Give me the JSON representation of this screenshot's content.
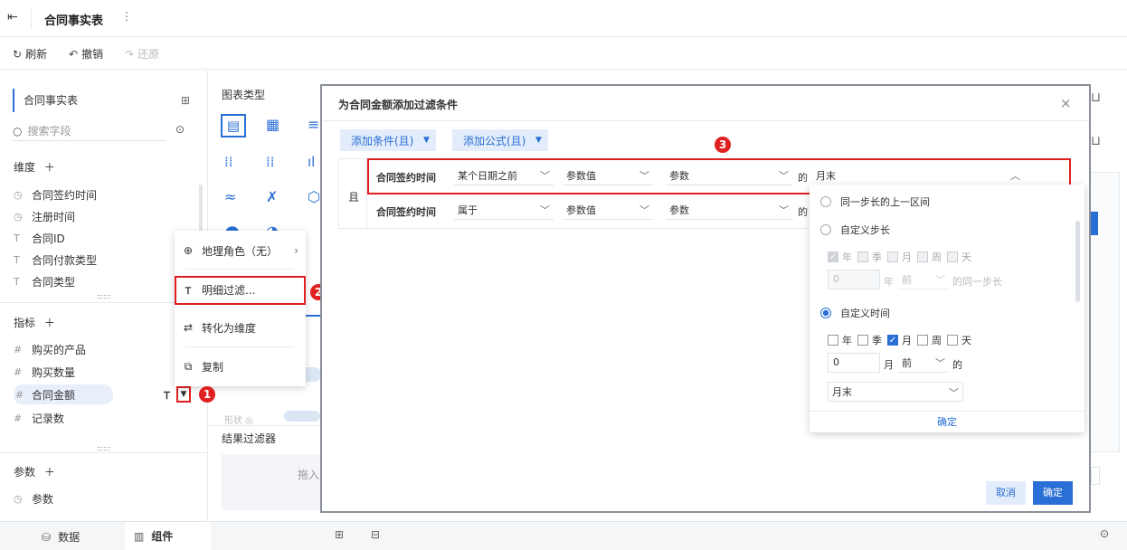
{
  "app": {
    "title": "合同事实表"
  },
  "toolbar": {
    "refresh": "刷新",
    "undo": "撤销",
    "redo": "还原"
  },
  "sidebar": {
    "table_name": "合同事实表",
    "search_placeholder": "搜索字段",
    "dimension_label": "维度",
    "dimensions": [
      "合同签约时间",
      "注册时间",
      "合同ID",
      "合同付款类型",
      "合同类型"
    ],
    "metric_label": "指标",
    "metrics": [
      "购买的产品",
      "购买数量",
      "合同金额",
      "记录数"
    ],
    "param_label": "参数",
    "params": [
      "参数"
    ]
  },
  "chartpanel": {
    "chart_type_label": "图表类型",
    "result_filter_label": "结果过滤器",
    "drag_hint": "拖入"
  },
  "context_menu": {
    "geo_role": "地理角色（无）",
    "detail_filter": "明细过滤...",
    "convert_dimension": "转化为维度",
    "copy": "复制"
  },
  "modal": {
    "title": "为合同金额添加过滤条件",
    "add_condition": "添加条件(且)",
    "add_formula": "添加公式(且)",
    "and_label": "且",
    "row1": {
      "field": "合同签约时间",
      "op": "某个日期之前",
      "valtype": "参数值",
      "param": "参数",
      "of": "的",
      "value": "月末"
    },
    "row2": {
      "field": "合同签约时间",
      "op": "属于",
      "valtype": "参数值",
      "param": "参数",
      "of": "的"
    },
    "cancel": "取消",
    "confirm": "确定"
  },
  "dropdown": {
    "opt_prev_interval": "同一步长的上一区间",
    "opt_custom_step": "自定义步长",
    "units": [
      "年",
      "季",
      "月",
      "周",
      "天"
    ],
    "step_value": "0",
    "step_unit": "年",
    "step_dir": "前",
    "step_suffix": "的同一步长",
    "opt_custom_time": "自定义时间",
    "time_value": "0",
    "time_unit": "月",
    "time_dir": "前",
    "time_of": "的",
    "time_end": "月末",
    "confirm": "确定"
  },
  "bottombar": {
    "data_tab": "数据",
    "component_tab": "组件"
  },
  "badges": [
    "1",
    "2",
    "3"
  ],
  "colors": {
    "accent": "#2a6fd6",
    "highlight": "#e02020"
  }
}
